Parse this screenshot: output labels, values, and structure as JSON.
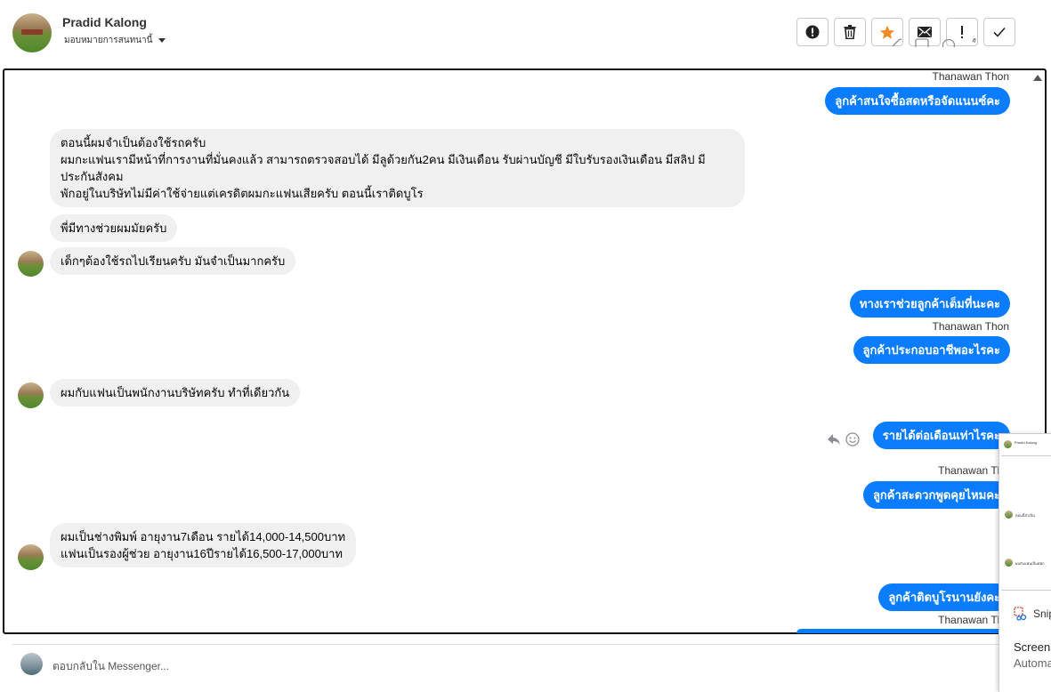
{
  "header": {
    "contact_name": "Pradid Kalong",
    "assign_label": "มอบหมายการสนทนานี้"
  },
  "messages": {
    "out1_sender": "Thanawan Thon",
    "out1": "ลูกค้าสนใจซื้อสดหรือจัดแนนซ์คะ",
    "in1": "ตอนนี้ผมจำเป็นต้องใช้รถครับ\nผมกะแฟนเรามีหน้าที่การงานที่มั่นคงแล้ว สามารถตรวจสอบได้ มีลูด้วยกัน2คน มีเงินเดือน รับผ่านบัญชี มีใบรับรองเงินเดือน มีสลิป มีประกันสังคม\nพักอยู่ในบริษัทไม่มีค่าใช้จ่ายแต่เครดิตผมกะแฟนเสียครับ ตอนนี้เราติดบูโร",
    "in2": "พี่มีทางช่วยผมมัยครับ",
    "in3": "เด็กๆต้องใช้รถไปเรียนครับ มันจำเป็นมากครับ",
    "out2": "ทางเราช่วยลูกค้าเต็มที่นะคะ",
    "out3_sender": "Thanawan Thon",
    "out3": "ลูกค้าประกอบอาชีพอะไรคะ",
    "in4": "ผมกับแฟนเป็นพนักงานบริษัทครับ ทำที่เดียวกัน",
    "out4": "รายได้ต่อเดือนเท่าไรคะ",
    "out5_sender": "Thanawan Tho",
    "out5": "ลูกค้าสะดวกพูดคุยไหมคะ",
    "in5": "ผมเป็นช่างพิมพ์ อายุงาน7เดือน รายได้14,000-14,500บาท\nแฟนเป็นรองผู้ช่วย อายุงาน16ปีรายได้16,500-17,000บาท",
    "out6": "ลูกค้าติดบูโรนานยังคะ",
    "out7_sender": "Thanawan Tho"
  },
  "composer": {
    "placeholder": "ตอบกลับใน Messenger..."
  },
  "popup": {
    "mini_name": "Pradid Kalong",
    "mini_msg1": "ตอนนี้จำเป็น",
    "mini_msg2": "ผมกับแฟนเป็นพนัก",
    "snip_app": "Snip",
    "snip_line1": "Screens",
    "snip_line2": "Automa"
  }
}
